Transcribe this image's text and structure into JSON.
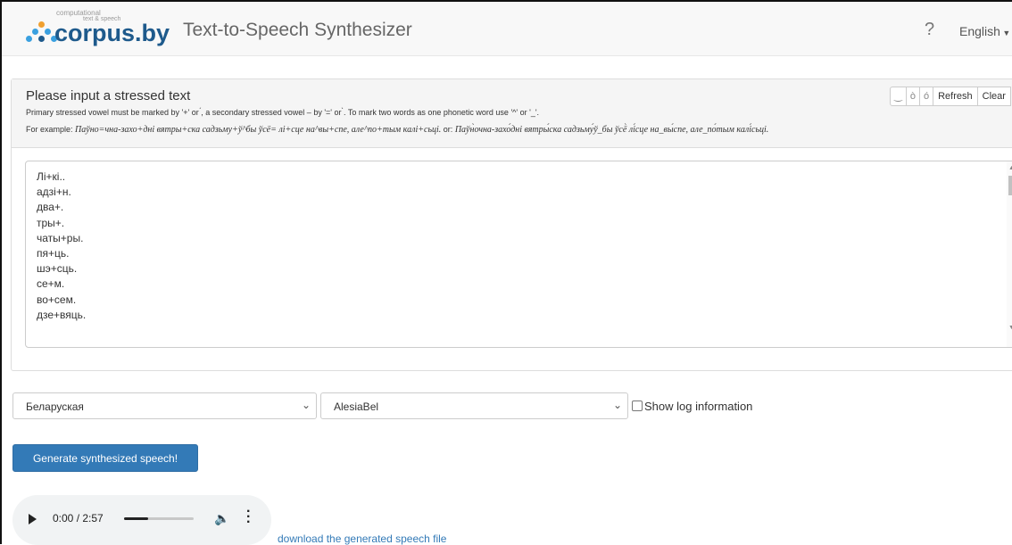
{
  "navbar": {
    "logo_top_text": "computational",
    "logo_sub_text": "text & speech",
    "logo_brand": "corpus",
    "logo_domain": ".by",
    "title": "Text-to-Speech Synthesizer",
    "help_icon": "?",
    "language": "English"
  },
  "panel": {
    "title": "Please input a stressed text",
    "hint_line1": "Primary stressed vowel must be marked by '+' or ́, a secondary stressed vowel – by '=' or ̀. To mark two words as one phonetic word use '^' or '_'.",
    "hint_example_prefix": "For example:",
    "hint_example_1": "Паўно=чна-захо+дні вятры+ска садзьму+ў^бы ўсё= лі+сце на^вы+спе, але^по+тым калі+сьці.",
    "hint_or": "or:",
    "hint_example_2": "Паўн̀очна-захо́дні вятры́ска садзьму́ў_бы ўсё̀ лі́сце на_вы́спе, але_по́тым калі́сьці.",
    "buttons": {
      "link": "‿",
      "secondary": "ò",
      "primary": "ó",
      "refresh": "Refresh",
      "clear": "Clear"
    },
    "text_lines": [
      "Лі+кі..",
      "адзі+н.",
      "два+.",
      "тры+.",
      "чаты+ры.",
      "пя+ць.",
      "шэ+сць.",
      "се+м.",
      "во+сем.",
      "дзе+вяць."
    ]
  },
  "controls": {
    "language_select": "Беларуская",
    "voice_select": "AlesiaBel",
    "show_log_label": "Show log information",
    "show_log_checked": false,
    "generate_label": "Generate synthesized speech!"
  },
  "player": {
    "time": "0:00 / 2:57",
    "progress": 0.0
  },
  "download_label": "download the generated speech file",
  "colors": {
    "accent": "#337ab7",
    "brand": "#1e5a8c"
  }
}
